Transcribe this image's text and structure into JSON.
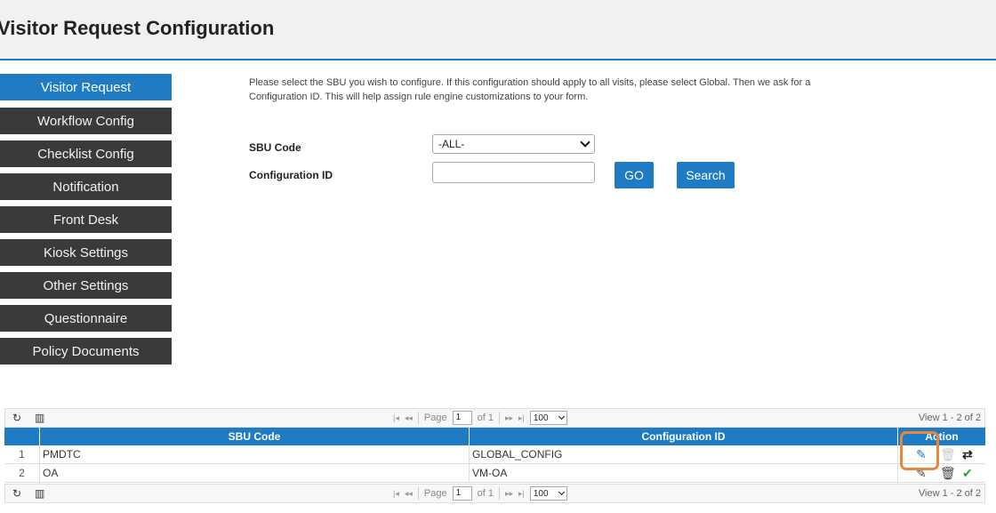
{
  "header": {
    "title": "Visitor Request Configuration"
  },
  "sidebar": {
    "items": [
      {
        "label": "Visitor Request",
        "active": true
      },
      {
        "label": "Workflow Config"
      },
      {
        "label": "Checklist Config"
      },
      {
        "label": "Notification"
      },
      {
        "label": "Front Desk"
      },
      {
        "label": "Kiosk Settings"
      },
      {
        "label": "Other Settings"
      },
      {
        "label": "Questionnaire"
      },
      {
        "label": "Policy Documents"
      }
    ]
  },
  "form": {
    "intro_line1": "Please select the SBU you wish to configure. If this configuration should apply to all visits, please select Global. Then we ask for a",
    "intro_line2": "Configuration ID. This will help assign rule engine customizations to your form.",
    "sbu_label": "SBU Code",
    "sbu_value": "-ALL-",
    "config_label": "Configuration ID",
    "config_value": "",
    "go_label": "GO",
    "search_label": "Search"
  },
  "grid": {
    "pager": {
      "page_label": "Page",
      "page_value": "1",
      "of_label": "of 1",
      "rows_per_page": "100",
      "view_text": "View 1 - 2 of 2"
    },
    "columns": {
      "sbu": "SBU Code",
      "config": "Configuration ID",
      "action": "Action"
    },
    "rows": [
      {
        "num": "1",
        "sbu": "PMDTC",
        "config": "GLOBAL_CONFIG"
      },
      {
        "num": "2",
        "sbu": "OA",
        "config": "VM-OA"
      }
    ]
  },
  "colors": {
    "accent": "#1f7bc4",
    "sidebar_bg": "#3a3a3a",
    "highlight": "#e8873a",
    "success": "#2e9e3a"
  },
  "icons": [
    "refresh-icon",
    "columns-icon",
    "first-page-icon",
    "prev-page-icon",
    "next-page-icon",
    "last-page-icon",
    "edit-icon",
    "delete-icon",
    "sync-icon",
    "check-circle-icon"
  ]
}
